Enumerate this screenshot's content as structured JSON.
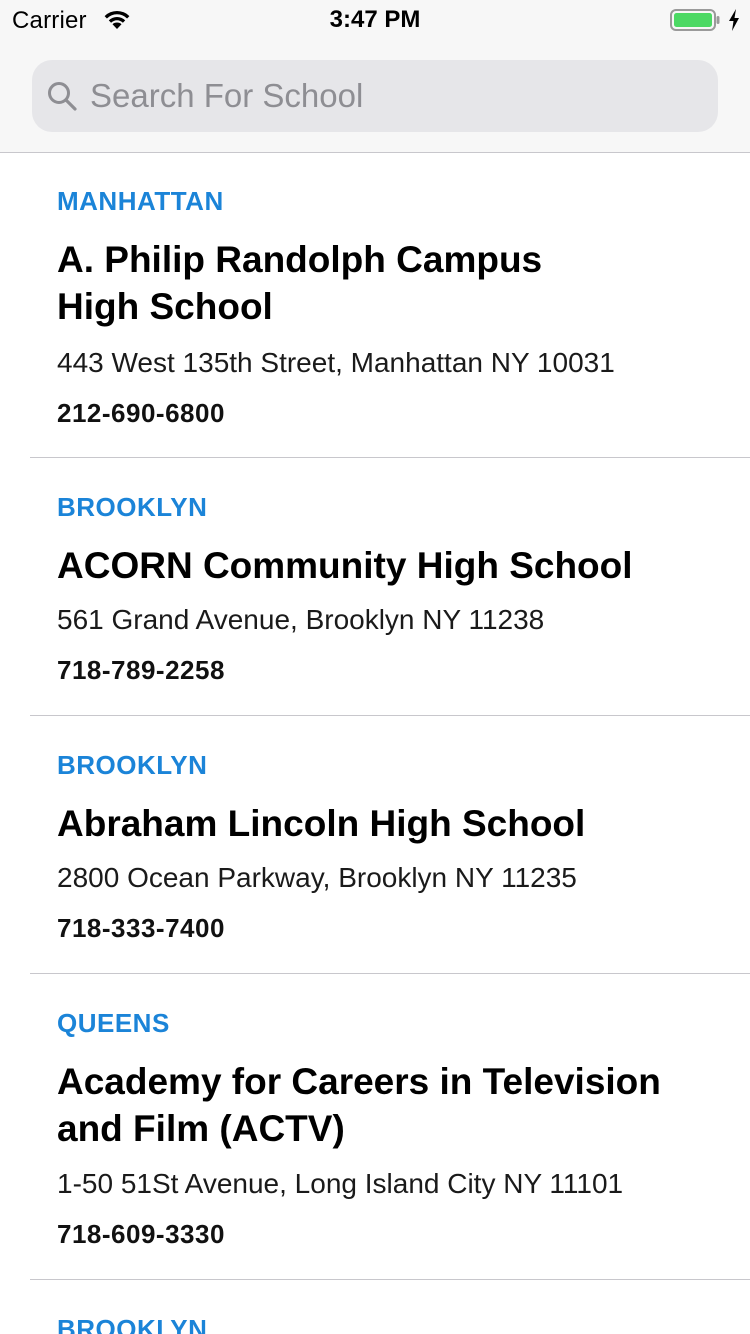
{
  "status_bar": {
    "carrier": "Carrier",
    "time": "3:47 PM",
    "battery_color": "#4cd964"
  },
  "search": {
    "placeholder": "Search For School",
    "value": ""
  },
  "colors": {
    "borough": "#1b84d8",
    "divider": "#c8c7cc"
  },
  "schools": [
    {
      "borough": "MANHATTAN",
      "name_line1": "A. Philip Randolph Campus",
      "name_line2": "High School",
      "address": "443 West 135th Street, Manhattan NY 10031",
      "phone": "212-690-6800"
    },
    {
      "borough": "BROOKLYN",
      "name_line1": "ACORN Community High School",
      "address": "561 Grand Avenue, Brooklyn NY 11238",
      "phone": "718-789-2258"
    },
    {
      "borough": "BROOKLYN",
      "name_line1": "Abraham Lincoln High School",
      "address": "2800 Ocean Parkway, Brooklyn NY 11235",
      "phone": "718-333-7400"
    },
    {
      "borough": "QUEENS",
      "name_line1": "Academy for Careers in Television",
      "name_line2": "and Film (ACTV)",
      "address": "1-50 51St Avenue, Long Island City NY 11101",
      "phone": "718-609-3330"
    },
    {
      "borough": "BROOKLYN"
    }
  ]
}
